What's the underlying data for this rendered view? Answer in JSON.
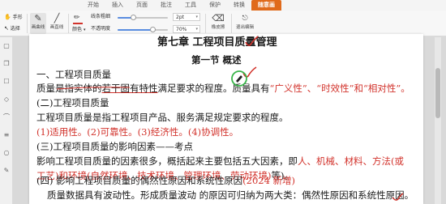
{
  "menu": {
    "tabs": [
      "开始",
      "插入",
      "页面",
      "批注",
      "工具",
      "保护",
      "转换",
      "随意画"
    ],
    "active_index": 7
  },
  "toolbar": {
    "hand_label": "手形",
    "select_label": "选择",
    "pen_label": "画曲线",
    "line_label": "画直线",
    "color_label": "颜色",
    "line_weight_label": "线条粗细",
    "line_weight_value": "2pt",
    "opacity_label": "不透明度",
    "opacity_value": "70%",
    "eraser_label": "橡皮擦",
    "exit_label": "退出编辑",
    "line_weight_level": 0.3,
    "opacity_level": 0.7,
    "pen_color": "#d2332c"
  },
  "doc": {
    "chapter_title": "第七章 工程项目质量管理",
    "section_title": "第一节 概述",
    "l1": "一、工程项目质量",
    "l2_a": "质量是指实体的",
    "l2_b": "若干固有特性",
    "l2_c": "满足要求的程度。质量具有",
    "l2_d": "“广义性”、“时效性”和“相对性”。",
    "l3": "(二)工程项目质量",
    "l4": "工程项目质量是指工程项目产品、服务满足规定要求的程度。",
    "l5": "(1)适用性。(2)可靠性。(3)经济性。(4)协调性。",
    "l6": "(三)工程项目质量的影响因素——考点",
    "l7_a": "影响工程项目质量的因素很多，概括起来主要包括五大因素，即",
    "l7_b": "人、机械、材料、方法(或",
    "l8": "工艺)和环境(自然环境、技术环境、管理环境、劳动环境)",
    "l8_tail": "等)。",
    "l9_a": "(四)   影响工程项目质量的偶然性原因和系统性原因",
    "l9_b": "(2024 新增)",
    "l10": "质量数据具有波动性。形成质量波动 的原因可归纳为两大类：偶然性原因和系统性原因。"
  }
}
